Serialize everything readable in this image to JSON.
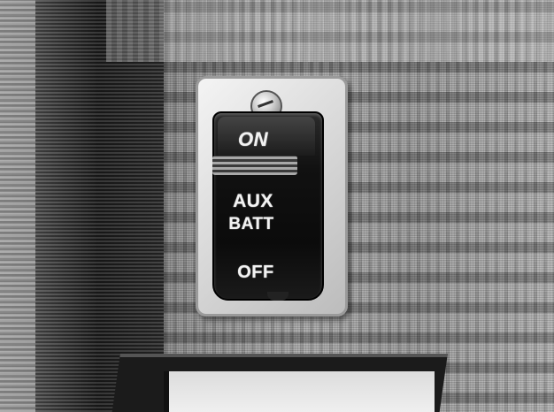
{
  "switch": {
    "on_label": "ON",
    "aux_label": "AUX",
    "batt_label": "BATT",
    "off_label": "OFF"
  }
}
